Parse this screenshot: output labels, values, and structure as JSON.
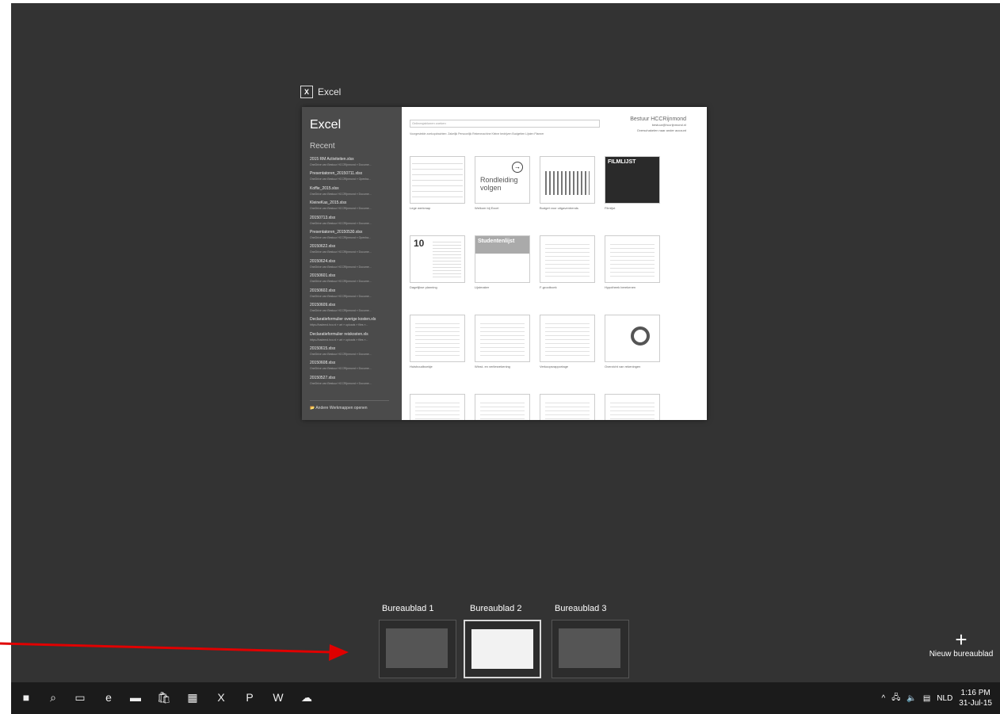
{
  "window": {
    "title": "Excel",
    "app_badge": "X",
    "backstage": {
      "app_name": "Excel",
      "recent_heading": "Recent",
      "search_placeholder": "Onlinesjablonen zoeken",
      "suggestions": "Voorgestelde zoekopdrachten: Zakelijk  Persoonlijk  Rekenmachine  Kleine bedrijven  Budgetten  Lijsten  Planner",
      "account_name": "Bestuur HCCRijnmond",
      "account_email": "bestuur@hccrijnmond.nl",
      "switch_account": "Overschakelen naar ander account",
      "recent_files": [
        {
          "name": "2015 RM Activiteiten.xlsx",
          "path": "OneDrive van Bestuur HCCRijnmond » Docume..."
        },
        {
          "name": "Presentatoren_20150711.xlsx",
          "path": "OneDrive van Bestuur HCCRijnmond » Openba..."
        },
        {
          "name": "Koffie_2015.xlsx",
          "path": "OneDrive van Bestuur HCCRijnmond » Docume..."
        },
        {
          "name": "KleineKas_2015.xlsx",
          "path": "OneDrive van Bestuur HCCRijnmond » Docume..."
        },
        {
          "name": "20150713.xlsx",
          "path": "OneDrive van Bestuur HCCRijnmond » Docume..."
        },
        {
          "name": "Presentatoren_20150530.xlsx",
          "path": "OneDrive van Bestuur HCCRijnmond » Openba..."
        },
        {
          "name": "20150622.xlsx",
          "path": "OneDrive van Bestuur HCCRijnmond » Docume..."
        },
        {
          "name": "20150624.xlsx",
          "path": "OneDrive van Bestuur HCCRijnmond » Docume..."
        },
        {
          "name": "20150601.xlsx",
          "path": "OneDrive van Bestuur HCCRijnmond » Docume..."
        },
        {
          "name": "20150602.xlsx",
          "path": "OneDrive van Bestuur HCCRijnmond » Docume..."
        },
        {
          "name": "20150609.xlsx",
          "path": "OneDrive van Bestuur HCCRijnmond » Docume..."
        },
        {
          "name": "Declaratieformulier overige kosten.xls",
          "path": "https://bademd.hcc.nl » art » uploads » files »..."
        },
        {
          "name": "Declaratieformulier reiskosten.xls",
          "path": "https://bademd.hcc.nl » art » uploads » files »..."
        },
        {
          "name": "20150615.xlsx",
          "path": "OneDrive van Bestuur HCCRijnmond » Docume..."
        },
        {
          "name": "20150608.xlsx",
          "path": "OneDrive van Bestuur HCCRijnmond » Docume..."
        },
        {
          "name": "20150527.xlsx",
          "path": "OneDrive van Bestuur HCCRijnmond » Docume..."
        }
      ],
      "open_other": "Andere Werkmappen openen",
      "templates": [
        {
          "label": "Lege werkmap",
          "kind": "blank"
        },
        {
          "label": "Welkom bij Excel",
          "kind": "tour",
          "text": "Rondleiding volgen"
        },
        {
          "label": "Budget voor uitgaventrends",
          "kind": "chart"
        },
        {
          "label": "Filmlijst",
          "kind": "dark",
          "text": "FILMLIJST"
        },
        {
          "label": "Dagelijkse planning",
          "kind": "planner",
          "text": "10"
        },
        {
          "label": "Lijstmaker",
          "kind": "student",
          "text": "Studentenlijst"
        },
        {
          "label": "F-grootboek",
          "kind": "table"
        },
        {
          "label": "Hypotheek berekenen",
          "kind": "table"
        },
        {
          "label": "Huishoudboekje",
          "kind": "table"
        },
        {
          "label": "Winst- en verliesrekening",
          "kind": "table"
        },
        {
          "label": "Verkoopsrapportage",
          "kind": "table"
        },
        {
          "label": "Overzicht van rekeningen",
          "kind": "donut"
        },
        {
          "label": "",
          "kind": "table"
        },
        {
          "label": "",
          "kind": "table"
        },
        {
          "label": "",
          "kind": "table"
        },
        {
          "label": "",
          "kind": "table"
        }
      ]
    }
  },
  "task_view": {
    "desktops": [
      {
        "label": "Bureaublad 1",
        "active": false
      },
      {
        "label": "Bureaublad 2",
        "active": true
      },
      {
        "label": "Bureaublad 3",
        "active": false
      }
    ],
    "new_desktop_label": "Nieuw bureaublad"
  },
  "taskbar": {
    "apps": [
      {
        "name": "start-icon",
        "glyph": "■"
      },
      {
        "name": "search-icon",
        "glyph": "⌕"
      },
      {
        "name": "task-view-icon",
        "glyph": "▭"
      },
      {
        "name": "edge-icon",
        "glyph": "e"
      },
      {
        "name": "file-explorer-icon",
        "glyph": "▬"
      },
      {
        "name": "store-icon",
        "glyph": "🛍"
      },
      {
        "name": "photos-icon",
        "glyph": "▦"
      },
      {
        "name": "excel-icon",
        "glyph": "X"
      },
      {
        "name": "powerpoint-icon",
        "glyph": "P"
      },
      {
        "name": "word-icon",
        "glyph": "W"
      },
      {
        "name": "onedrive-icon",
        "glyph": "☁"
      }
    ],
    "tray": {
      "chevron": "^",
      "language": "NLD",
      "time": "1:16 PM",
      "date": "31-Jul-15"
    }
  },
  "colors": {
    "background": "#333333",
    "taskbar": "#1b1b1b",
    "annotation_arrow": "#e00000"
  }
}
